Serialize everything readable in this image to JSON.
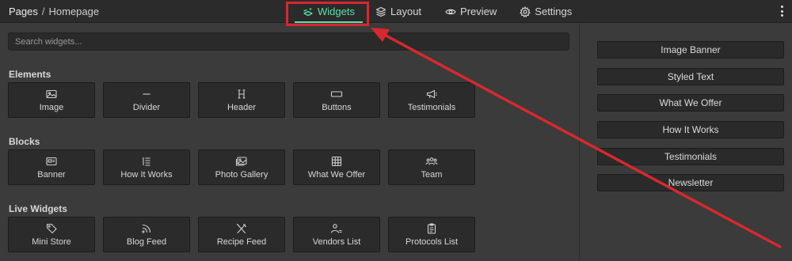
{
  "header": {
    "breadcrumb_root": "Pages",
    "breadcrumb_separator": "/",
    "breadcrumb_current": "Homepage",
    "tabs": [
      {
        "label": "Widgets",
        "icon": "widgets-icon",
        "active": true
      },
      {
        "label": "Layout",
        "icon": "layers-icon",
        "active": false
      },
      {
        "label": "Preview",
        "icon": "eye-icon",
        "active": false
      },
      {
        "label": "Settings",
        "icon": "gear-icon",
        "active": false
      }
    ],
    "more_icon": "kebab-menu-icon"
  },
  "search": {
    "placeholder": "Search widgets...",
    "value": ""
  },
  "sections": [
    {
      "title": "Elements",
      "items": [
        {
          "label": "Image",
          "icon": "image-icon"
        },
        {
          "label": "Divider",
          "icon": "divider-icon"
        },
        {
          "label": "Header",
          "icon": "heading-icon"
        },
        {
          "label": "Buttons",
          "icon": "button-icon"
        },
        {
          "label": "Testimonials",
          "icon": "megaphone-icon"
        }
      ]
    },
    {
      "title": "Blocks",
      "items": [
        {
          "label": "Banner",
          "icon": "banner-icon"
        },
        {
          "label": "How It Works",
          "icon": "list-icon"
        },
        {
          "label": "Photo Gallery",
          "icon": "gallery-icon"
        },
        {
          "label": "What We Offer",
          "icon": "grid-icon"
        },
        {
          "label": "Team",
          "icon": "team-icon"
        }
      ]
    },
    {
      "title": "Live Widgets",
      "items": [
        {
          "label": "Mini Store",
          "icon": "tag-icon"
        },
        {
          "label": "Blog Feed",
          "icon": "rss-icon"
        },
        {
          "label": "Recipe Feed",
          "icon": "utensils-icon"
        },
        {
          "label": "Vendors List",
          "icon": "user-list-icon"
        },
        {
          "label": "Protocols List",
          "icon": "clipboard-icon"
        }
      ]
    }
  ],
  "page_sections": [
    "Image Banner",
    "Styled Text",
    "What We Offer",
    "How It Works",
    "Testimonials",
    "Newsletter"
  ],
  "colors": {
    "accent": "#5ce0a6",
    "annotation": "#d7282f",
    "background": "#3a3b3a",
    "surface": "#2b2b2b"
  }
}
